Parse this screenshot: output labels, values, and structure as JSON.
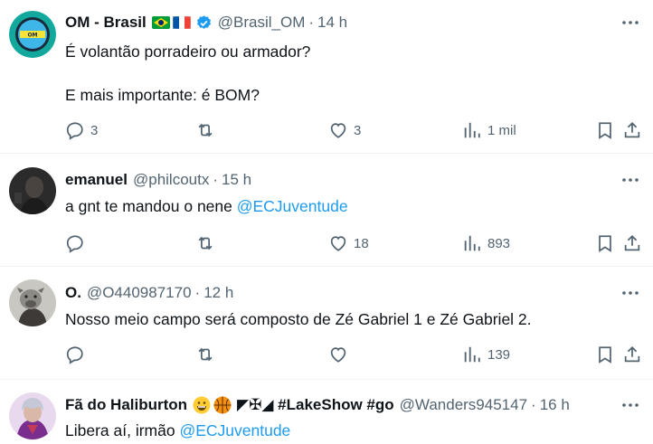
{
  "tweets": [
    {
      "name": "OM - Brasil",
      "handle": "@Brasil_OM",
      "time": "14 h",
      "flags": [
        "brazil-flag-icon",
        "france-flag-icon"
      ],
      "verified": true,
      "text_lines": [
        "É volantão porradeiro ou armador?",
        "E mais importante: é BOM?"
      ],
      "replies": "3",
      "retweets": "",
      "likes": "3",
      "views": "1 mil"
    },
    {
      "name": "emanuel",
      "handle": "@philcoutx",
      "time": "15 h",
      "text": "a gnt te mandou o nene ",
      "mention": "@ECJuventude",
      "replies": "",
      "retweets": "",
      "likes": "18",
      "views": "893"
    },
    {
      "name": "O.",
      "handle": "@O440987170",
      "time": "12 h",
      "text": "Nosso meio campo será composto de Zé Gabriel 1 e Zé Gabriel 2.",
      "replies": "",
      "retweets": "",
      "likes": "",
      "views": "139"
    },
    {
      "name": "Fã do Haliburton",
      "name_extra": "◤✠◢ #LakeShow #go",
      "handle": "@Wanders945147",
      "time": "16 h",
      "text": "Libera aí, irmão ",
      "mention": "@ECJuventude"
    }
  ],
  "separator": "·",
  "colors": {
    "text": "#0f1419",
    "secondary": "#536471",
    "link": "#1d9bf0",
    "verified": "#1d9bf0",
    "divider": "#eff3f4"
  }
}
